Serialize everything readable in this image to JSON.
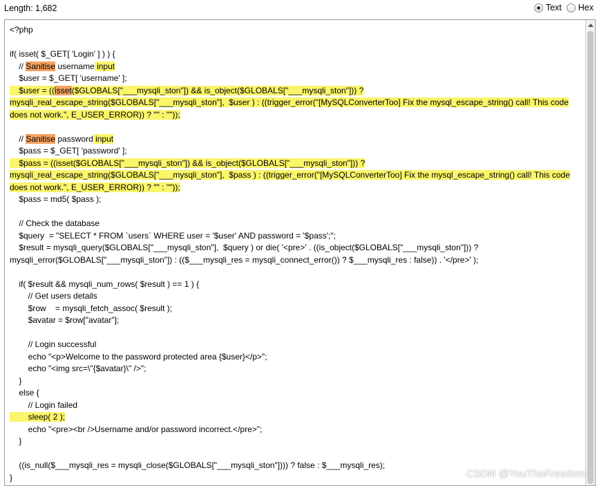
{
  "header": {
    "length_label": "Length: 1,682",
    "modes": [
      {
        "label": "Text",
        "selected": true
      },
      {
        "label": "Hex",
        "selected": false
      }
    ]
  },
  "code": {
    "highlight_colors": {
      "yellow": "#faf56a",
      "orange": "#f4a262"
    },
    "lines": [
      [
        {
          "t": "<?php"
        }
      ],
      [],
      [
        {
          "t": "if( isset( $_GET[ 'Login' ] ) ) {"
        }
      ],
      [
        {
          "t": "    // "
        },
        {
          "t": "Sanitise",
          "h": "o"
        },
        {
          "t": " username"
        },
        {
          "t": " input",
          "h": "y"
        }
      ],
      [
        {
          "t": "    $user = $_GET[ 'username' ];"
        }
      ],
      [
        {
          "t": "    $user = ((",
          "h": "y"
        },
        {
          "t": "isset",
          "h": "o"
        },
        {
          "t": "($GLOBALS[\"___mysqli_ston\"]) && is_object($GLOBALS[\"___mysqli_ston\"])) ?",
          "h": "y"
        }
      ],
      [
        {
          "t": "mysqli_real_escape_string($GLOBALS[\"___mysqli_ston\"],  $user ) : ((trigger_error(\"[MySQLConverterToo] Fix the mysql_escape_string() call! This code",
          "h": "y"
        }
      ],
      [
        {
          "t": "does not work.\", E_USER_ERROR)) ? \"\" : \"\"));",
          "h": "y"
        }
      ],
      [],
      [
        {
          "t": "    // "
        },
        {
          "t": "Sanitise",
          "h": "o"
        },
        {
          "t": " password"
        },
        {
          "t": " input",
          "h": "y"
        }
      ],
      [
        {
          "t": "    $pass = $_GET[ 'password' ];"
        }
      ],
      [
        {
          "t": "    $pass = ((isset($GLOBALS[\"___mysqli_ston\"]) && is_object($GLOBALS[\"___mysqli_ston\"])) ?",
          "h": "y"
        }
      ],
      [
        {
          "t": "mysqli_real_escape_string($GLOBALS[\"___mysqli_ston\"],  $pass ) : ((trigger_error(\"[MySQLConverterToo] Fix the mysql_escape_string() call! This code",
          "h": "y"
        }
      ],
      [
        {
          "t": "does not work.\", E_USER_ERROR)) ? \"\" : \"\"));",
          "h": "y"
        }
      ],
      [
        {
          "t": "    $pass = md5( $pass );"
        }
      ],
      [],
      [
        {
          "t": "    // Check the database"
        }
      ],
      [
        {
          "t": "    $query  = \"SELECT * FROM `users` WHERE user = '$user' AND password = '$pass';\";"
        }
      ],
      [
        {
          "t": "    $result = mysqli_query($GLOBALS[\"___mysqli_ston\"],  $query ) or die( '<pre>' . ((is_object($GLOBALS[\"___mysqli_ston\"])) ?"
        }
      ],
      [
        {
          "t": "mysqli_error($GLOBALS[\"___mysqli_ston\"]) : (($___mysqli_res = mysqli_connect_error()) ? $___mysqli_res : false)) . '</pre>' );"
        }
      ],
      [],
      [
        {
          "t": "    if( $result && mysqli_num_rows( $result ) == 1 ) {"
        }
      ],
      [
        {
          "t": "        // Get users details"
        }
      ],
      [
        {
          "t": "        $row    = mysqli_fetch_assoc( $result );"
        }
      ],
      [
        {
          "t": "        $avatar = $row[\"avatar\"];"
        }
      ],
      [],
      [
        {
          "t": "        // Login successful"
        }
      ],
      [
        {
          "t": "        echo \"<p>Welcome to the password protected area {$user}</p>\";"
        }
      ],
      [
        {
          "t": "        echo \"<img src=\\\"{$avatar}\\\" />\";"
        }
      ],
      [
        {
          "t": "    }"
        }
      ],
      [
        {
          "t": "    else {"
        }
      ],
      [
        {
          "t": "        // Login failed"
        }
      ],
      [
        {
          "t": "        sleep( 2 );",
          "h": "y"
        }
      ],
      [
        {
          "t": "        echo \"<pre><br />Username and/or password incorrect.</pre>\";"
        }
      ],
      [
        {
          "t": "    }"
        }
      ],
      [],
      [
        {
          "t": "    ((is_null($___mysqli_res = mysqli_close($GLOBALS[\"___mysqli_ston\"]))) ? false : $___mysqli_res);"
        }
      ],
      [
        {
          "t": "}"
        }
      ]
    ]
  },
  "watermark": "CSDN @YouTheFreedom"
}
